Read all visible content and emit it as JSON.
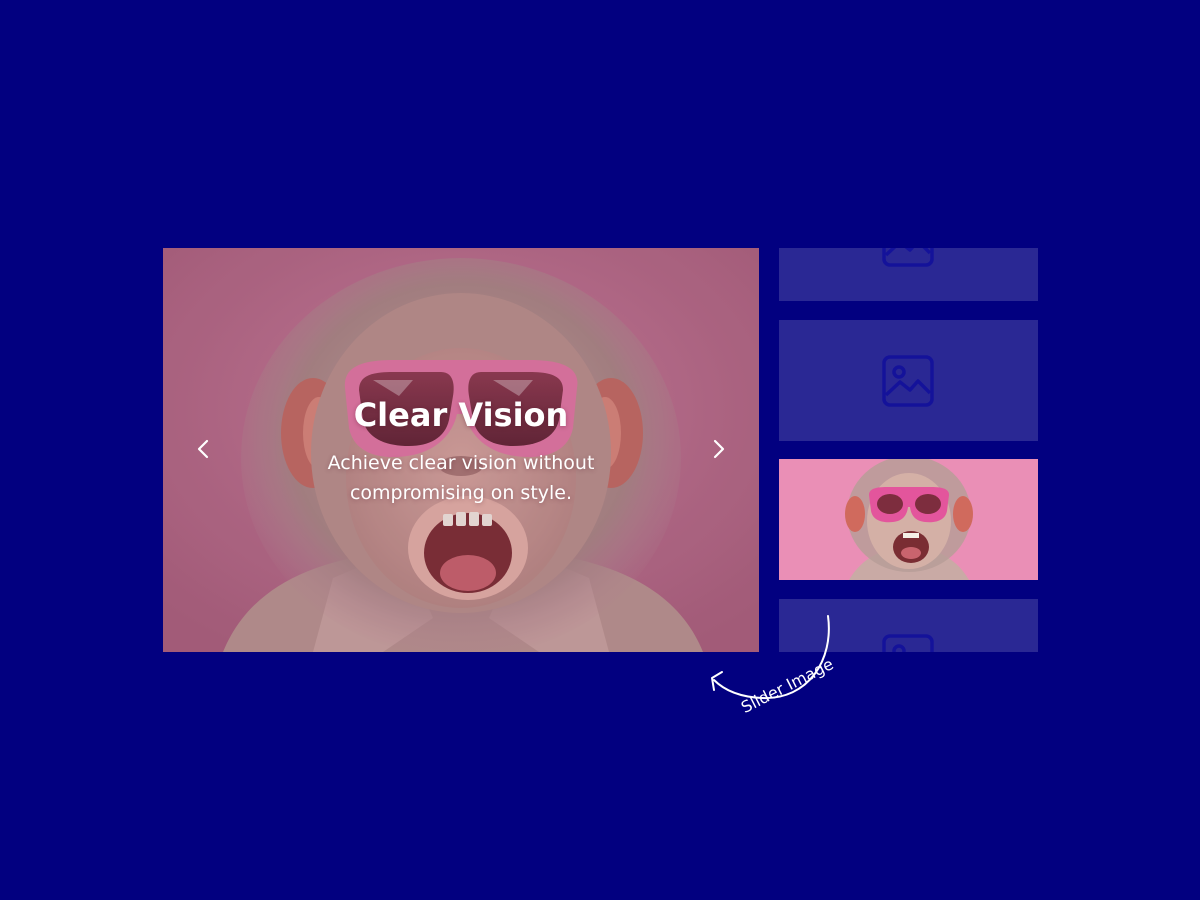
{
  "slider": {
    "title": "Clear Vision",
    "description": "Achieve clear vision without compromising on style.",
    "prev_icon": "chevron-left-icon",
    "next_icon": "chevron-right-icon"
  },
  "thumbnails": [
    {
      "kind": "placeholder",
      "icon": "image-placeholder-icon"
    },
    {
      "kind": "placeholder",
      "icon": "image-placeholder-icon"
    },
    {
      "kind": "image",
      "subject": "monkey with pink sunglasses"
    },
    {
      "kind": "placeholder",
      "icon": "image-placeholder-icon"
    }
  ],
  "annotation": {
    "label": "Slider Image"
  },
  "colors": {
    "background": "#020080",
    "thumbnail_placeholder": "#2a2894",
    "placeholder_icon": "#14129a",
    "slide_pink": "#b26d8a"
  }
}
